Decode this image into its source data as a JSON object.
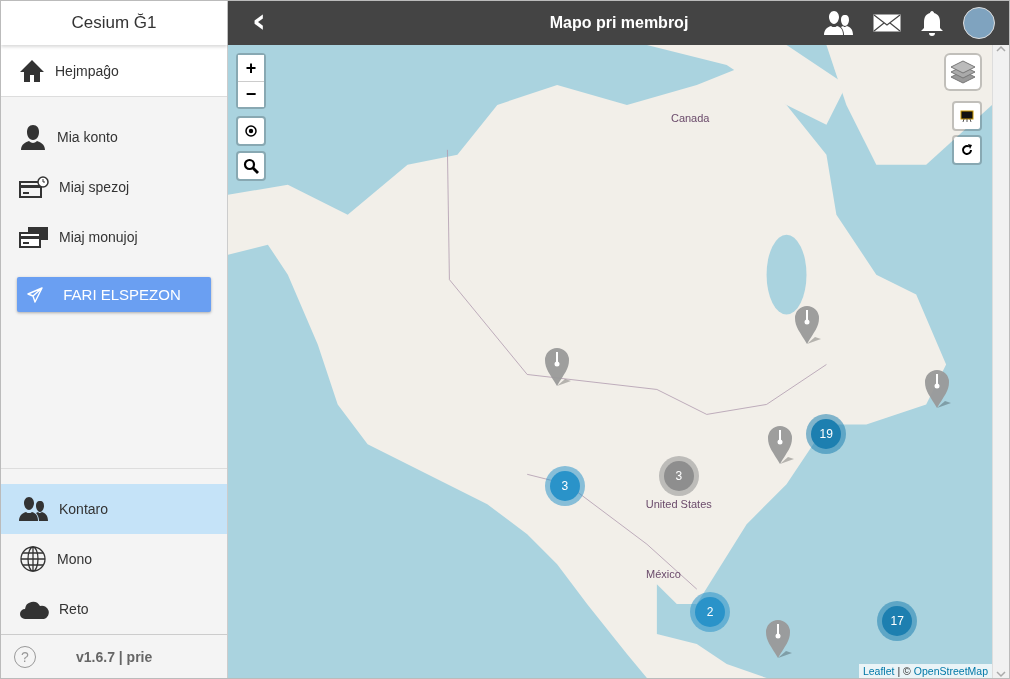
{
  "sidebar": {
    "title": "Cesium Ğ1",
    "home": {
      "label": "Hejmpaĝo"
    },
    "account_items": [
      {
        "label": "Mia konto"
      },
      {
        "label": "Miaj spezoj"
      },
      {
        "label": "Miaj monujoj"
      }
    ],
    "send_button": "FARI ELSPEZON",
    "community_items": [
      {
        "label": "Kontaro",
        "selected": true
      },
      {
        "label": "Mono",
        "selected": false
      },
      {
        "label": "Reto",
        "selected": false
      }
    ],
    "help": "?",
    "version": "v1.6.7 | prie"
  },
  "header": {
    "back": "‹",
    "title": "Mapo pri membroj"
  },
  "map": {
    "zoom_in": "+",
    "zoom_out": "−",
    "place_labels": [
      "Canada",
      "United States",
      "México"
    ],
    "clusters": [
      {
        "count": "3",
        "color": "#8e8e8e"
      },
      {
        "count": "3",
        "color": "#2a93c9"
      },
      {
        "count": "19",
        "color": "#1d7fb0"
      },
      {
        "count": "2",
        "color": "#2a93c9"
      },
      {
        "count": "17",
        "color": "#1d7fb0"
      }
    ],
    "attribution": {
      "leaflet": "Leaflet",
      "separator": "| ©",
      "osm": "OpenStreetMap"
    }
  }
}
